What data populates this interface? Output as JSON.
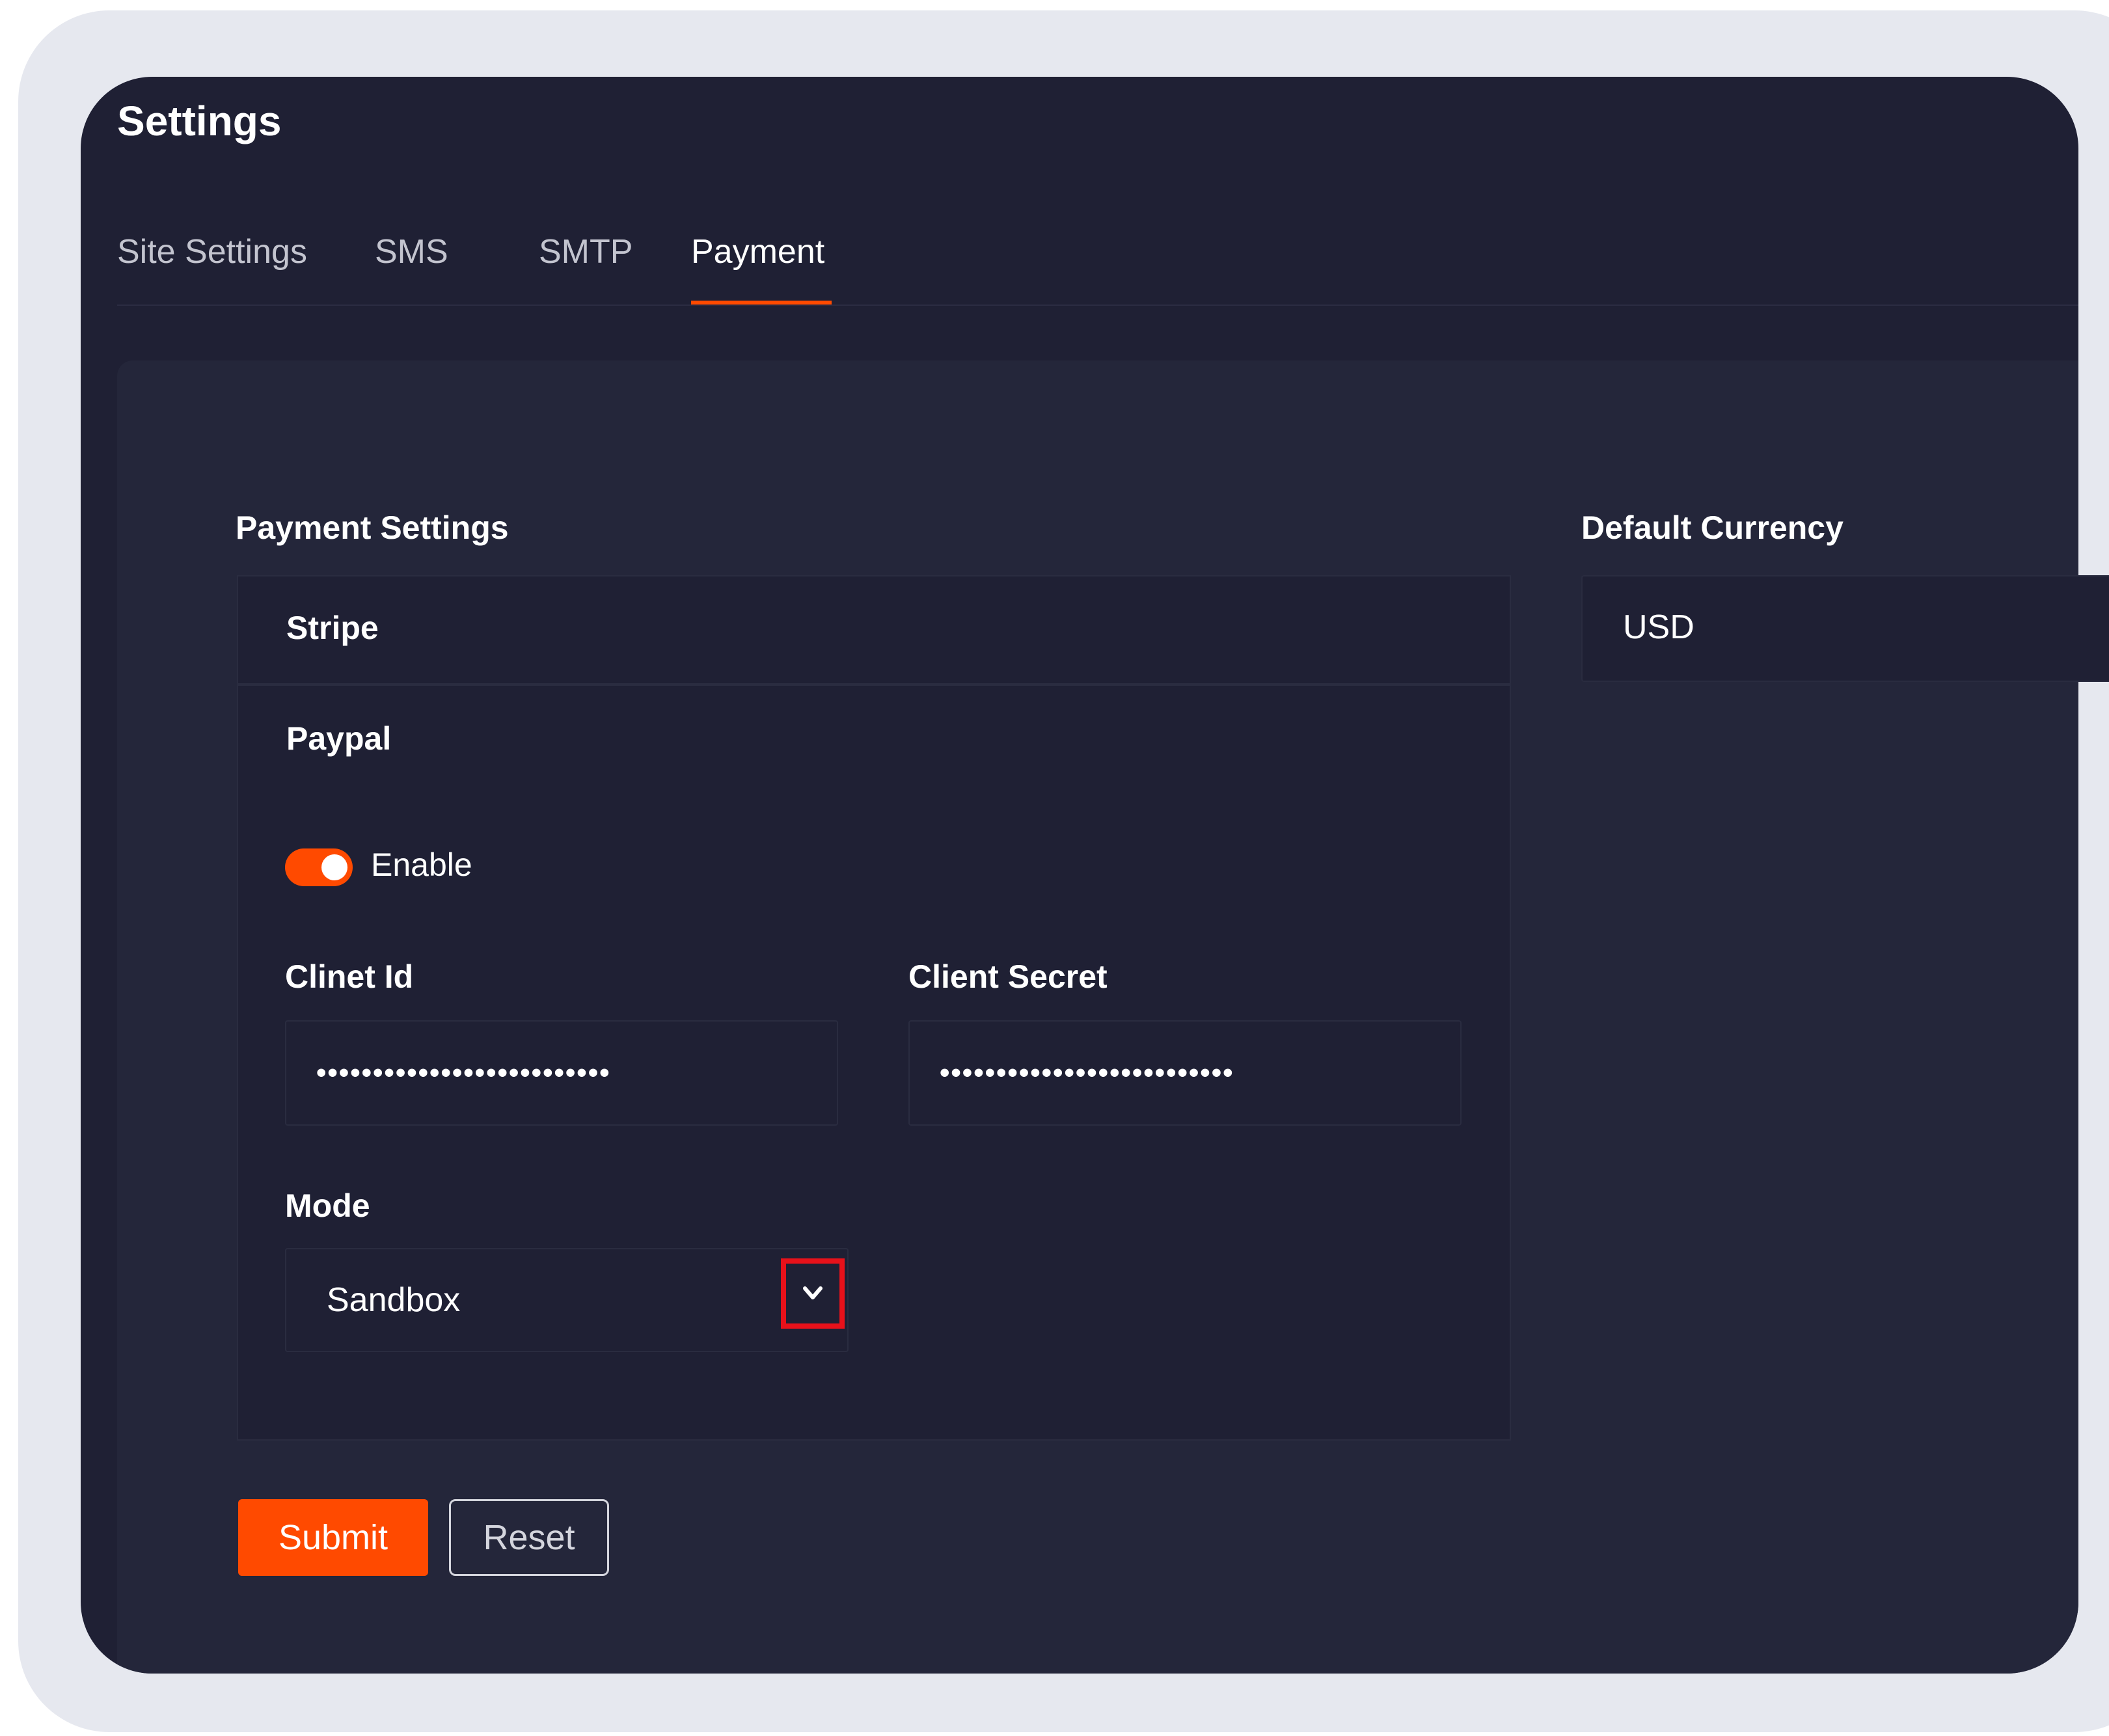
{
  "header": {
    "title": "Settings"
  },
  "tabs": [
    {
      "label": "Site Settings",
      "active": false
    },
    {
      "label": "SMS",
      "active": false
    },
    {
      "label": "SMTP",
      "active": false
    },
    {
      "label": "Payment",
      "active": true
    }
  ],
  "payment": {
    "section_label": "Payment Settings",
    "stripe_label": "Stripe",
    "paypal_label": "Paypal",
    "enable_label": "Enable",
    "enabled": true,
    "client_id_label": "Clinet Id",
    "client_id_value": "••••••••••••••••••••••••••",
    "client_secret_label": "Client Secret",
    "client_secret_value": "••••••••••••••••••••••••••",
    "mode_label": "Mode",
    "mode_value": "Sandbox"
  },
  "currency": {
    "label": "Default Currency",
    "value": "USD"
  },
  "actions": {
    "submit_label": "Submit",
    "reset_label": "Reset"
  },
  "colors": {
    "accent": "#ff4a00",
    "card_bg": "#1f2034",
    "panel_bg": "#24263a",
    "highlight": "#e8111a"
  }
}
